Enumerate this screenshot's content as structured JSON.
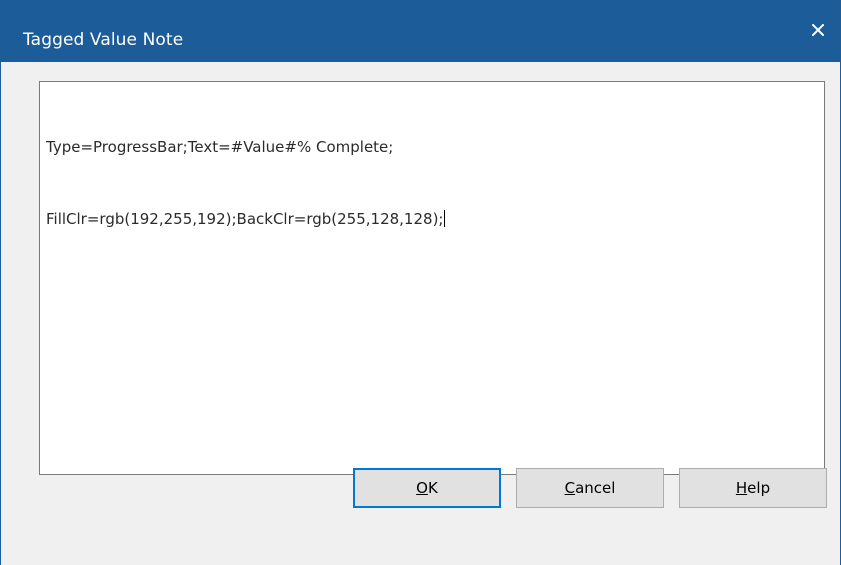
{
  "window": {
    "title": "Tagged Value Note"
  },
  "icons": {
    "close": "close-icon"
  },
  "note": {
    "lines": [
      "Type=ProgressBar;Text=#Value#% Complete;",
      "FillClr=rgb(192,255,192);BackClr=rgb(255,128,128);"
    ]
  },
  "buttons": {
    "ok": {
      "mnemonic": "O",
      "rest": "K"
    },
    "cancel": {
      "mnemonic": "C",
      "rest": "ancel"
    },
    "help": {
      "mnemonic": "H",
      "rest": "elp"
    }
  },
  "colors": {
    "titlebar": "#1c5c99",
    "dialog_bg": "#f0f0f0",
    "button_bg": "#e1e1e1",
    "focus_border": "#0078d7"
  }
}
